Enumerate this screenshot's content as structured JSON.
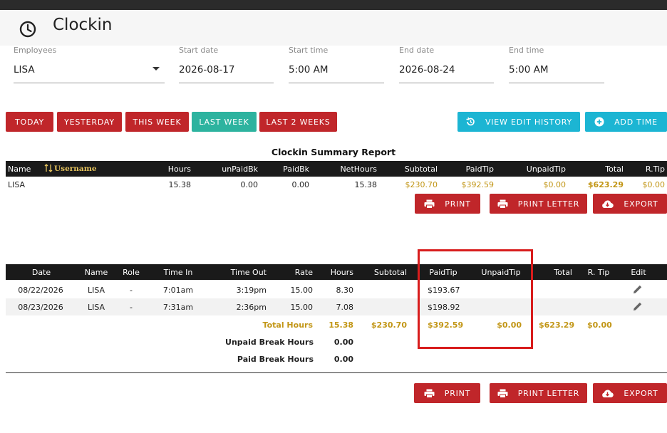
{
  "app": {
    "title": "Clockin",
    "icon": "clock-icon"
  },
  "filters": {
    "employees": {
      "label": "Employees",
      "value": "LISA"
    },
    "start_date": {
      "label": "Start date",
      "value": "2026-08-17"
    },
    "start_time": {
      "label": "Start time",
      "value": "5:00 AM"
    },
    "end_date": {
      "label": "End date",
      "value": "2026-08-24"
    },
    "end_time": {
      "label": "End time",
      "value": "5:00 AM"
    }
  },
  "quick_ranges": {
    "today": "TODAY",
    "yesterday": "YESTERDAY",
    "this_week": "THIS WEEK",
    "last_week": "LAST WEEK",
    "last_2_weeks": "LAST 2 WEEKS"
  },
  "actions": {
    "view_edit_history": "VIEW EDIT HISTORY",
    "add_time": "ADD TIME",
    "print": "PRINT",
    "print_letter": "PRINT LETTER",
    "export": "EXPORT"
  },
  "summary": {
    "title": "Clockin Summary Report",
    "headers": {
      "name": "Name",
      "username": "Username",
      "hours": "Hours",
      "unpaid_bk": "unPaidBk",
      "paid_bk": "PaidBk",
      "net_hours": "NetHours",
      "subtotal": "Subtotal",
      "paid_tip": "PaidTip",
      "unpaid_tip": "UnpaidTip",
      "total": "Total",
      "r_tip": "R.Tip"
    },
    "row": {
      "name": "LISA",
      "hours": "15.38",
      "unpaid_bk": "0.00",
      "paid_bk": "0.00",
      "net_hours": "15.38",
      "subtotal": "$230.70",
      "paid_tip": "$392.59",
      "unpaid_tip": "$0.00",
      "total": "$623.29",
      "r_tip": "$0.00"
    }
  },
  "detail": {
    "headers": {
      "date": "Date",
      "name": "Name",
      "role": "Role",
      "time_in": "Time In",
      "time_out": "Time Out",
      "rate": "Rate",
      "hours": "Hours",
      "subtotal": "Subtotal",
      "paid_tip": "PaidTip",
      "unpaid_tip": "UnpaidTip",
      "total": "Total",
      "r_tip": "R. Tip",
      "edit": "Edit"
    },
    "rows": [
      {
        "date": "08/22/2026",
        "name": "LISA",
        "role": "-",
        "time_in": "7:01am",
        "time_out": "3:19pm",
        "rate": "15.00",
        "hours": "8.30",
        "paid_tip": "$193.67"
      },
      {
        "date": "08/23/2026",
        "name": "LISA",
        "role": "-",
        "time_in": "7:31am",
        "time_out": "2:36pm",
        "rate": "15.00",
        "hours": "7.08",
        "paid_tip": "$198.92"
      }
    ],
    "totals": {
      "label": "Total Hours",
      "hours": "15.38",
      "subtotal": "$230.70",
      "paid_tip": "$392.59",
      "unpaid_tip": "$0.00",
      "total": "$623.29",
      "r_tip": "$0.00"
    },
    "unpaid_break": {
      "label": "Unpaid Break Hours",
      "value": "0.00"
    },
    "paid_break": {
      "label": "Paid Break Hours",
      "value": "0.00"
    }
  },
  "colors": {
    "primary_red": "#c0262a",
    "teal_active": "#2db39f",
    "cyan_action": "#1cb5d3",
    "gold_text": "#c29616",
    "highlight_border": "#d81c1c"
  }
}
